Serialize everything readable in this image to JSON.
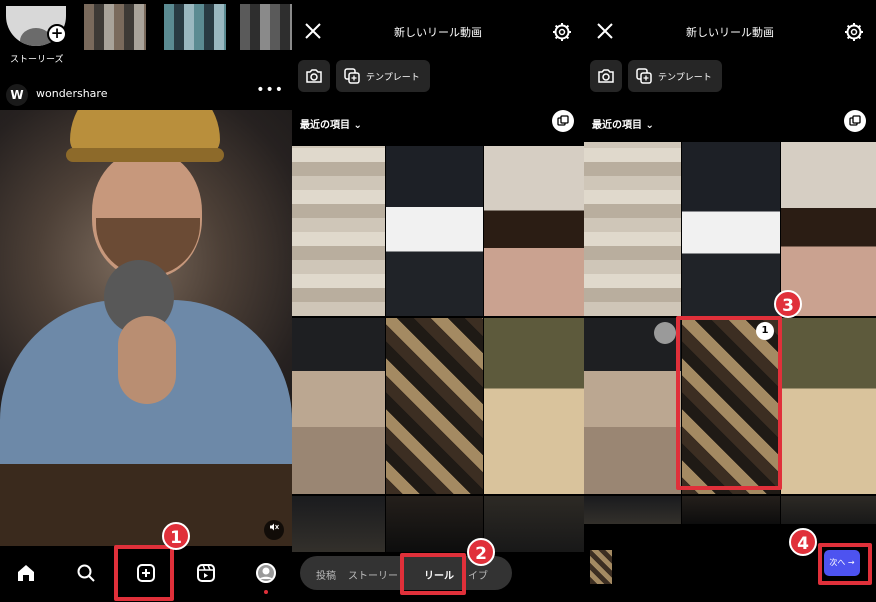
{
  "feed": {
    "story_label": "ストーリーズ",
    "brand_logo": "W",
    "account": "wondershare",
    "more": "•••",
    "nav": [
      "home-icon",
      "search-icon",
      "create-icon",
      "reels-icon",
      "profile-icon"
    ]
  },
  "picker": {
    "title": "新しいリール動画",
    "template_label": "テンプレート",
    "recent_label": "最近の項目",
    "tabs": [
      "投稿",
      "ストーリー",
      "リール",
      "ライブ"
    ],
    "tabs_visible": {
      "post": "投稿",
      "story": "ストーリー",
      "reel": "リール",
      "live": "イブ"
    },
    "selection_number": "1",
    "next_label": "次へ →"
  },
  "steps": [
    "1",
    "2",
    "3",
    "4"
  ],
  "colors": {
    "highlight": "#e0303a",
    "next_button": "#4d53f0",
    "background": "#000000"
  }
}
